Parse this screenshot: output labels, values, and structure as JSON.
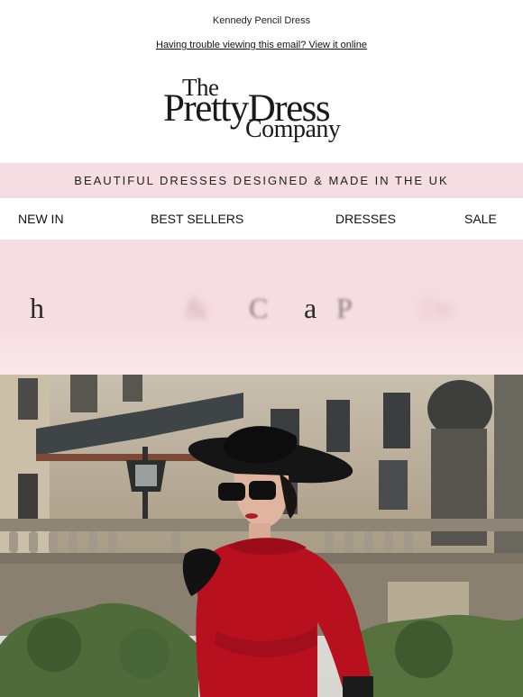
{
  "preheader": "Kennedy Pencil Dress",
  "view_online": "Having trouble viewing this email? View it online",
  "logo": {
    "line1": "The",
    "line2": "PrettyDress",
    "line3": "Company"
  },
  "banner": "BEAUTIFUL DRESSES DESIGNED & MADE IN THE UK",
  "nav": [
    "NEW IN",
    "BEST SELLERS",
    "DRESSES",
    "SALE"
  ],
  "hero_text": {
    "chars": [
      "h",
      "&",
      "C",
      "a",
      "P",
      "De"
    ]
  },
  "colors": {
    "banner_bg": "#f6dde3",
    "dress_red": "#b8101f"
  }
}
